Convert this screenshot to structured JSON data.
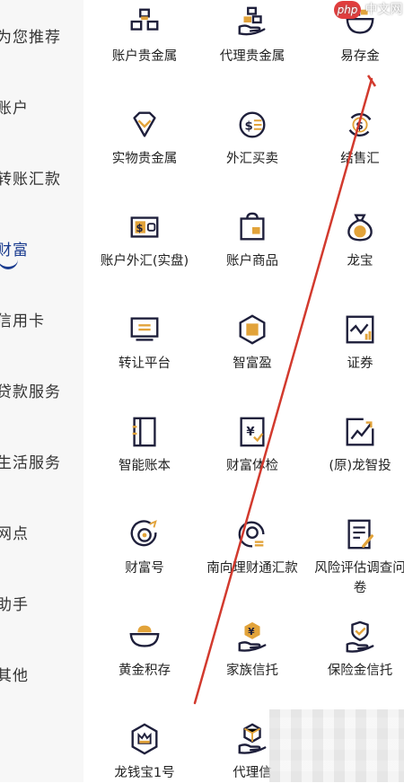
{
  "sidebar": {
    "items": [
      {
        "label": "为您推荐",
        "active": false
      },
      {
        "label": "账户",
        "active": false
      },
      {
        "label": "转账汇款",
        "active": false
      },
      {
        "label": "财富",
        "active": true
      },
      {
        "label": "信用卡",
        "active": false
      },
      {
        "label": "贷款服务",
        "active": false
      },
      {
        "label": "生活服务",
        "active": false
      },
      {
        "label": "网点",
        "active": false
      },
      {
        "label": "助手",
        "active": false
      },
      {
        "label": "其他",
        "active": false
      }
    ]
  },
  "grid": {
    "items": [
      {
        "label": "账户贵金属",
        "icon": "gold-bars-icon"
      },
      {
        "label": "代理贵金属",
        "icon": "gold-hand-icon"
      },
      {
        "label": "易存金",
        "icon": "gold-bowl-icon"
      },
      {
        "label": "实物贵金属",
        "icon": "diamond-icon"
      },
      {
        "label": "外汇买卖",
        "icon": "exchange-icon"
      },
      {
        "label": "结售汇",
        "icon": "currency-cycle-icon"
      },
      {
        "label": "账户外汇(实盘)",
        "icon": "wallet-dollar-icon"
      },
      {
        "label": "账户商品",
        "icon": "shopping-bag-icon"
      },
      {
        "label": "龙宝",
        "icon": "money-bag-icon"
      },
      {
        "label": "转让平台",
        "icon": "transfer-monitor-icon"
      },
      {
        "label": "智富盈",
        "icon": "hexagon-badge-icon"
      },
      {
        "label": "证券",
        "icon": "stock-chart-icon"
      },
      {
        "label": "智能账本",
        "icon": "ledger-book-icon"
      },
      {
        "label": "财富体检",
        "icon": "checkup-clipboard-icon"
      },
      {
        "label": "(原)龙智投",
        "icon": "trend-up-icon"
      },
      {
        "label": "财富号",
        "icon": "target-icon"
      },
      {
        "label": "南向理财通汇款",
        "icon": "cross-border-icon"
      },
      {
        "label": "风险评估调查问卷",
        "icon": "survey-form-icon"
      },
      {
        "label": "黄金积存",
        "icon": "gold-ingot-icon"
      },
      {
        "label": "家族信托",
        "icon": "family-trust-icon"
      },
      {
        "label": "保险金信托",
        "icon": "insurance-trust-icon"
      },
      {
        "label": "龙钱宝1号",
        "icon": "crown-badge-icon"
      },
      {
        "label": "代理信",
        "icon": "cube-hand-icon"
      }
    ]
  },
  "watermark": {
    "logo": "php",
    "text": "中文网"
  },
  "colors": {
    "icon_dark": "#1e1f3b",
    "icon_gold": "#e2a33a",
    "accent": "#1b3c8f",
    "pen_line": "#d23a2e"
  }
}
